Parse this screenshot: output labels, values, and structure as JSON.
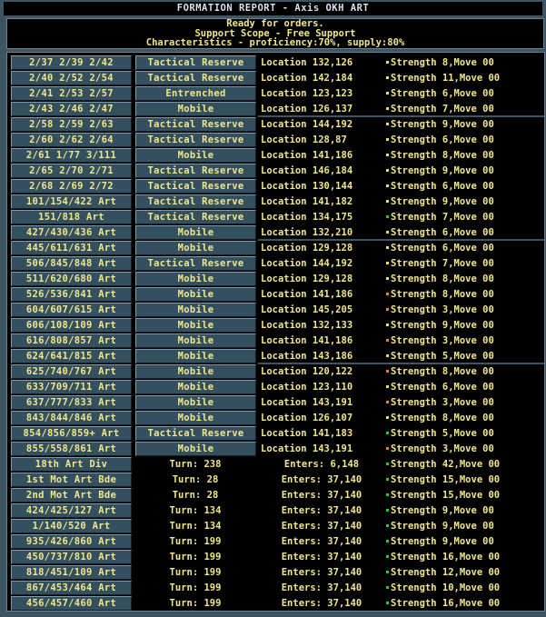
{
  "title": "FORMATION REPORT - Axis OKH ART",
  "messages": [
    "Ready for orders.",
    "Support Scope - Free Support",
    "Characteristics - proficiency:70%, supply:80%"
  ],
  "colors": {
    "yellow": "#f0e050",
    "green": "#20d020",
    "orange": "#f08020"
  },
  "units": [
    {
      "name": "2/37 2/39 2/42",
      "status": "Tactical Reserve",
      "location": "Location 132,126",
      "dot": "yellow",
      "strength": "Strength 8,Move 00"
    },
    {
      "name": "2/40 2/52 2/54",
      "status": "Tactical Reserve",
      "location": "Location 142,184",
      "dot": "yellow",
      "strength": "Strength 11,Move 00"
    },
    {
      "name": "2/41 2/53 2/57",
      "status": "Entrenched",
      "location": "Location 123,123",
      "dot": "yellow",
      "strength": "Strength 6,Move 00"
    },
    {
      "name": "2/43 2/46 2/47",
      "status": "Mobile",
      "location": "Location 126,137",
      "dot": "yellow",
      "strength": "Strength 7,Move 00"
    },
    {
      "name": "2/58 2/59 2/63",
      "status": "Tactical Reserve",
      "location": "Location 144,192",
      "dot": "yellow",
      "strength": "Strength 9,Move 00"
    },
    {
      "name": "2/60 2/62 2/64",
      "status": "Tactical Reserve",
      "location": " Location 128,87",
      "dot": "yellow",
      "strength": "Strength 6,Move 00"
    },
    {
      "name": "2/61 1/77 3/111",
      "status": "Mobile",
      "location": "Location 141,186",
      "dot": "yellow",
      "strength": "Strength 8,Move 00"
    },
    {
      "name": "2/65 2/70 2/71",
      "status": "Tactical Reserve",
      "location": "Location 146,184",
      "dot": "yellow",
      "strength": "Strength 9,Move 00"
    },
    {
      "name": "2/68 2/69 2/72",
      "status": "Tactical Reserve",
      "location": "Location 130,144",
      "dot": "yellow",
      "strength": "Strength 6,Move 00"
    },
    {
      "name": "101/154/422 Art",
      "status": "Tactical Reserve",
      "location": "Location 141,182",
      "dot": "yellow",
      "strength": "Strength 9,Move 00"
    },
    {
      "name": "151/818 Art",
      "status": "Tactical Reserve",
      "location": "Location 134,175",
      "dot": "green",
      "strength": "Strength 7,Move 00"
    },
    {
      "name": "427/430/436 Art",
      "status": "Mobile",
      "location": "Location 132,210",
      "dot": "yellow",
      "strength": "Strength 6,Move 00"
    },
    {
      "name": "445/611/631 Art",
      "status": "Mobile",
      "location": "Location 129,128",
      "dot": "yellow",
      "strength": "Strength 6,Move 00"
    },
    {
      "name": "506/845/848 Art",
      "status": "Tactical Reserve",
      "location": "Location 144,192",
      "dot": "yellow",
      "strength": "Strength 7,Move 00"
    },
    {
      "name": "511/620/680 Art",
      "status": "Mobile",
      "location": "Location 129,128",
      "dot": "yellow",
      "strength": "Strength 8,Move 00"
    },
    {
      "name": "526/536/841 Art",
      "status": "Mobile",
      "location": "Location 141,186",
      "dot": "orange",
      "strength": "Strength 8,Move 00"
    },
    {
      "name": "604/607/615 Art",
      "status": "Mobile",
      "location": "Location 145,205",
      "dot": "orange",
      "strength": "Strength 3,Move 00"
    },
    {
      "name": "606/108/109 Art",
      "status": "Mobile",
      "location": "Location 132,133",
      "dot": "yellow",
      "strength": "Strength 9,Move 00"
    },
    {
      "name": "616/808/857 Art",
      "status": "Mobile",
      "location": "Location 141,186",
      "dot": "orange",
      "strength": "Strength 3,Move 00"
    },
    {
      "name": "624/641/815 Art",
      "status": "Mobile",
      "location": "Location 143,186",
      "dot": "yellow",
      "strength": "Strength 5,Move 00"
    },
    {
      "name": "625/740/767 Art",
      "status": "Mobile",
      "location": "Location 120,122",
      "dot": "orange",
      "strength": "Strength 8,Move 00"
    },
    {
      "name": "633/709/711 Art",
      "status": "Mobile",
      "location": "Location 123,110",
      "dot": "yellow",
      "strength": "Strength 6,Move 00"
    },
    {
      "name": "637/777/833 Art",
      "status": "Mobile",
      "location": "Location 143,191",
      "dot": "orange",
      "strength": "Strength 3,Move 00"
    },
    {
      "name": "843/844/846 Art",
      "status": "Mobile",
      "location": "Location 126,107",
      "dot": "yellow",
      "strength": "Strength 8,Move 00"
    },
    {
      "name": "854/856/859+ Art",
      "status": "Tactical Reserve",
      "location": "Location 141,183",
      "dot": "green",
      "strength": "Strength 5,Move 00"
    },
    {
      "name": "855/558/861 Art",
      "status": "Mobile",
      "location": "Location 143,191",
      "dot": "orange",
      "strength": "Strength 3,Move 00"
    }
  ],
  "reinforcements": [
    {
      "name": "18th Art Div",
      "turn": "Turn: 238",
      "enters": "Enters: 6,148",
      "strength": "Strength 42,Move 00"
    },
    {
      "name": "1st Mot Art Bde",
      "turn": "Turn: 28",
      "enters": "Enters: 37,140",
      "strength": "Strength 15,Move 00"
    },
    {
      "name": "2nd Mot Art Bde",
      "turn": "Turn: 28",
      "enters": "Enters: 37,140",
      "strength": "Strength 15,Move 00"
    },
    {
      "name": "424/425/127 Art",
      "turn": "Turn: 134",
      "enters": "Enters: 37,140",
      "strength": "Strength 9,Move 00"
    },
    {
      "name": "1/140/520 Art",
      "turn": "Turn: 134",
      "enters": "Enters: 37,140",
      "strength": "Strength 9,Move 00"
    },
    {
      "name": "935/426/860 Art",
      "turn": "Turn: 199",
      "enters": "Enters: 37,140",
      "strength": "Strength 9,Move 00"
    },
    {
      "name": "450/737/810 Art",
      "turn": "Turn: 199",
      "enters": "Enters: 37,140",
      "strength": "Strength 16,Move 00"
    },
    {
      "name": "818/451/109 Art",
      "turn": "Turn: 199",
      "enters": "Enters: 37,140",
      "strength": "Strength 12,Move 00"
    },
    {
      "name": "867/453/464 Art",
      "turn": "Turn: 199",
      "enters": "Enters: 37,140",
      "strength": "Strength 10,Move 00"
    },
    {
      "name": "456/457/460 Art",
      "turn": "Turn: 199",
      "enters": "Enters: 37,140",
      "strength": "Strength 16,Move 00"
    }
  ]
}
